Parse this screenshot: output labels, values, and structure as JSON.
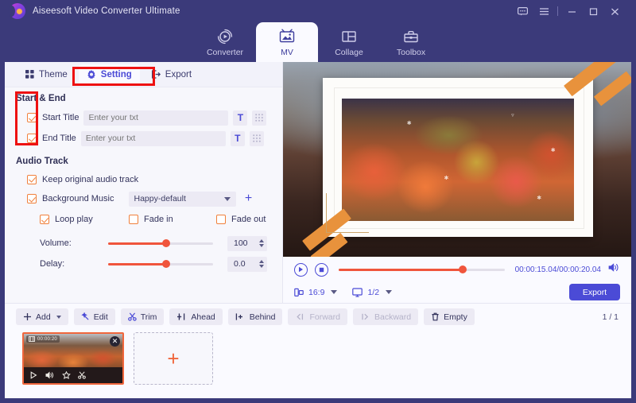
{
  "window": {
    "app_title": "Aiseesoft Video Converter Ultimate",
    "logo_icon": "aiseesoft-logo-icon",
    "controls": [
      {
        "name": "feedback-icon",
        "glyph": "chat"
      },
      {
        "name": "menu-icon",
        "glyph": "hamburger"
      },
      {
        "name": "minimize-icon",
        "glyph": "minimize"
      },
      {
        "name": "maximize-icon",
        "glyph": "maximize"
      },
      {
        "name": "close-icon",
        "glyph": "close"
      }
    ]
  },
  "module_tabs": [
    {
      "label": "Converter",
      "icon": "converter-icon",
      "active": false
    },
    {
      "label": "MV",
      "icon": "mv-icon",
      "active": true
    },
    {
      "label": "Collage",
      "icon": "collage-icon",
      "active": false
    },
    {
      "label": "Toolbox",
      "icon": "toolbox-icon",
      "active": false
    }
  ],
  "sub_tabs": [
    {
      "label": "Theme",
      "icon": "theme-grid-icon",
      "active": false
    },
    {
      "label": "Setting",
      "icon": "gear-icon",
      "active": true
    },
    {
      "label": "Export",
      "icon": "export-icon",
      "active": false
    }
  ],
  "settings": {
    "start_end": {
      "section_title": "Start & End",
      "start_title": {
        "label": "Start Title",
        "checked": true,
        "value": "",
        "placeholder": "Enter your txt",
        "text_style_icon": "text-style-icon",
        "position_icon": "position-grid-icon"
      },
      "end_title": {
        "label": "End Title",
        "checked": true,
        "value": "",
        "placeholder": "Enter your txt",
        "text_style_icon": "text-style-icon",
        "position_icon": "position-grid-icon"
      }
    },
    "audio_track": {
      "section_title": "Audio Track",
      "keep_original": {
        "label": "Keep original audio track",
        "checked": true
      },
      "background_music": {
        "label": "Background Music",
        "checked": true,
        "selected": "Happy-default",
        "add_icon": "plus-icon"
      },
      "loop_play": {
        "label": "Loop play",
        "checked": true
      },
      "fade_in": {
        "label": "Fade in",
        "checked": false
      },
      "fade_out": {
        "label": "Fade out",
        "checked": false
      },
      "volume": {
        "label": "Volume:",
        "value": "100",
        "percent": 55
      },
      "delay": {
        "label": "Delay:",
        "value": "0.0",
        "percent": 55
      }
    }
  },
  "preview": {
    "play_icon": "play-icon",
    "stop_icon": "stop-icon",
    "timecode": "00:00:15.04/00:00:20.04",
    "progress_percent": 75,
    "volume_icon": "volume-icon",
    "aspect_ratio": {
      "icon": "aspect-ratio-icon",
      "value": "16:9"
    },
    "screen_scale": {
      "icon": "monitor-icon",
      "value": "1/2"
    },
    "export_button": "Export"
  },
  "toolbar": [
    {
      "label": "Add",
      "icon": "plus-icon",
      "dropdown": true,
      "disabled": false
    },
    {
      "label": "Edit",
      "icon": "magic-wand-icon",
      "dropdown": false,
      "disabled": false
    },
    {
      "label": "Trim",
      "icon": "scissors-icon",
      "dropdown": false,
      "disabled": false
    },
    {
      "label": "Ahead",
      "icon": "insert-ahead-icon",
      "dropdown": false,
      "disabled": false
    },
    {
      "label": "Behind",
      "icon": "insert-behind-icon",
      "dropdown": false,
      "disabled": false
    },
    {
      "label": "Forward",
      "icon": "move-forward-icon",
      "dropdown": false,
      "disabled": true
    },
    {
      "label": "Backward",
      "icon": "move-backward-icon",
      "dropdown": false,
      "disabled": true
    },
    {
      "label": "Empty",
      "icon": "trash-icon",
      "dropdown": false,
      "disabled": false
    }
  ],
  "page_indicator": "1 / 1",
  "clips": {
    "item": {
      "duration_label": "00:00:20",
      "close_icon": "close-icon",
      "actions": [
        {
          "name": "play-icon"
        },
        {
          "name": "volume-icon"
        },
        {
          "name": "effect-icon"
        },
        {
          "name": "trim-icon"
        }
      ]
    },
    "add_tile": {
      "label": "+",
      "icon": "plus-icon"
    }
  },
  "annotations": [
    {
      "name": "annotation-setting-tab",
      "color": "#ee1111"
    },
    {
      "name": "annotation-title-checkboxes",
      "color": "#ee1111"
    }
  ],
  "colors": {
    "titlebar": "#3b3a7a",
    "accent_blue": "#4b4bd6",
    "accent_orange": "#f0663c",
    "slider_red": "#f0553c",
    "annotation_red": "#ee1111"
  }
}
